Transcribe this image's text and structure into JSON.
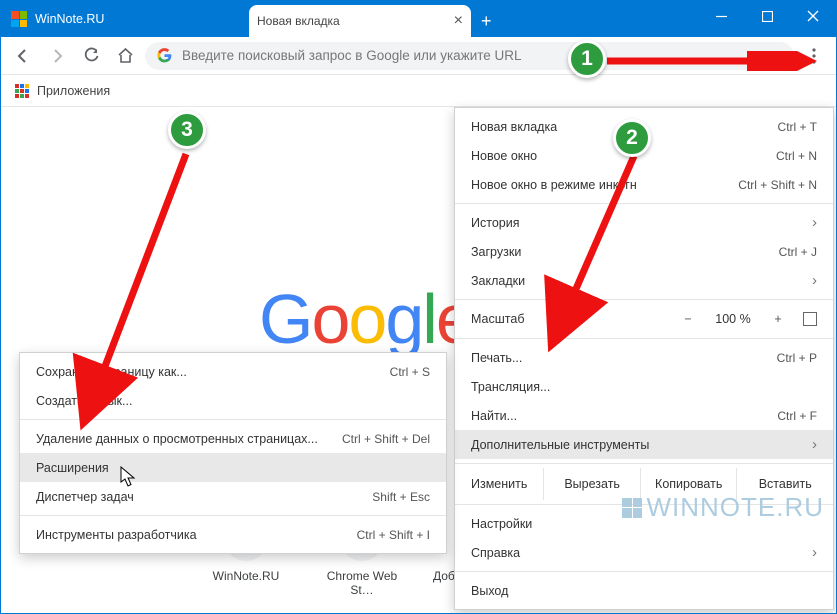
{
  "title_bar": {
    "app_tab": "WinNote.RU",
    "new_tab": "Новая вкладка"
  },
  "toolbar": {
    "address_placeholder": "Введите поисковый запрос в Google или укажите URL"
  },
  "bookmarks": {
    "apps": "Приложения"
  },
  "shortcuts": {
    "s1": "WinNote.RU",
    "s2": "Chrome Web St…",
    "s3": "Добавить ярлык"
  },
  "main_menu": {
    "new_tab": {
      "l": "Новая вкладка",
      "sc": "Ctrl + T"
    },
    "new_win": {
      "l": "Новое окно",
      "sc": "Ctrl + N"
    },
    "incognito": {
      "l": "Новое окно в режиме инкогн",
      "sc": "Ctrl + Shift + N"
    },
    "history": {
      "l": "История"
    },
    "downloads": {
      "l": "Загрузки",
      "sc": "Ctrl + J"
    },
    "bookmarks": {
      "l": "Закладки"
    },
    "zoom": {
      "l": "Масштаб",
      "minus": "−",
      "pct": "100 %",
      "plus": "+"
    },
    "print": {
      "l": "Печать...",
      "sc": "Ctrl + P"
    },
    "cast": {
      "l": "Трансляция..."
    },
    "find": {
      "l": "Найти...",
      "sc": "Ctrl + F"
    },
    "more_tools": {
      "l": "Дополнительные инструменты"
    },
    "edit": {
      "l": "Изменить",
      "cut": "Вырезать",
      "copy": "Копировать",
      "paste": "Вставить"
    },
    "settings": {
      "l": "Настройки"
    },
    "help": {
      "l": "Справка"
    },
    "exit": {
      "l": "Выход"
    }
  },
  "submenu": {
    "save_as": {
      "l": "Сохранить страницу как...",
      "sc": "Ctrl + S"
    },
    "shortcut": {
      "l": "Создать ярлык..."
    },
    "clear": {
      "l": "Удаление данных о просмотренных страницах...",
      "sc": "Ctrl + Shift + Del"
    },
    "extensions": {
      "l": "Расширения"
    },
    "taskmgr": {
      "l": "Диспетчер задач",
      "sc": "Shift + Esc"
    },
    "devtools": {
      "l": "Инструменты разработчика",
      "sc": "Ctrl + Shift + I"
    }
  },
  "badges": {
    "b1": "1",
    "b2": "2",
    "b3": "3"
  },
  "watermark": "WINNOTE.RU"
}
